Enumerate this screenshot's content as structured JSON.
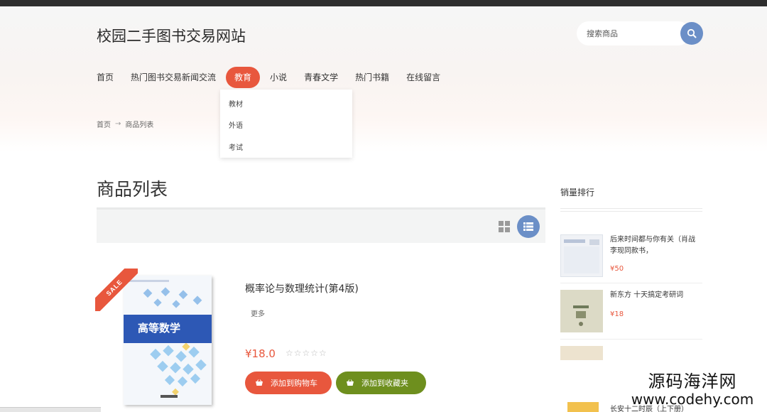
{
  "site": {
    "title": "校园二手图书交易网站"
  },
  "search": {
    "placeholder": "搜索商品"
  },
  "nav": {
    "items": [
      {
        "label": "首页"
      },
      {
        "label": "热门图书交易新闻交流"
      },
      {
        "label": "教育",
        "active": true
      },
      {
        "label": "小说"
      },
      {
        "label": "青春文学"
      },
      {
        "label": "热门书籍"
      },
      {
        "label": "在线留言"
      }
    ],
    "dropdown": [
      "教材",
      "外语",
      "考试"
    ]
  },
  "breadcrumb": {
    "home": "首页",
    "separator": "→",
    "current": "商品列表"
  },
  "page": {
    "title": "商品列表"
  },
  "product": {
    "sale_badge": "SALE",
    "cover_title": "高等数学",
    "name": "概率论与数理统计(第4版)",
    "more": "更多",
    "price": "¥18.0",
    "rating": 0,
    "stars": "☆☆☆☆☆",
    "add_to_cart": "添加到购物车",
    "add_to_favorites": "添加到收藏夹"
  },
  "sidebar": {
    "title": "销量排行",
    "items": [
      {
        "name": "后来时间都与你有关（肖战李现同款书，",
        "price": "¥50"
      },
      {
        "name": "新东方 十天搞定考研词",
        "price": "¥18"
      },
      {
        "name": "长安十二时辰（上下册）",
        "price": ""
      }
    ]
  },
  "watermark": {
    "line1": "源码海洋网",
    "line2": "www.codehy.com"
  },
  "colors": {
    "accent": "#e8573d",
    "blue": "#6b8fc7",
    "green": "#6e8f1e"
  }
}
